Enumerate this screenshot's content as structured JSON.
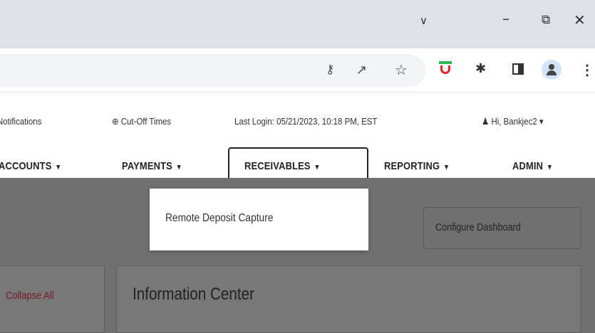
{
  "browser": {
    "window_controls": {
      "tab_search": "∨",
      "minimize": "–",
      "restore": "⧉",
      "close": "✕"
    },
    "toolbar_icons": [
      "key-icon",
      "share-icon",
      "bookmark-star-icon",
      "extension-red-icon",
      "puzzle-extensions-icon",
      "side-panel-icon",
      "profile-icon",
      "menu-kebab-icon"
    ],
    "glyphs": {
      "key": "⚷",
      "share": "↗",
      "star": "☆",
      "puzzle": "✱",
      "kebab": "⋮"
    }
  },
  "header": {
    "notifications_label": "Notifications",
    "cutoff_icon": "⊕",
    "cutoff_label": "Cut-Off Times",
    "last_login": "Last Login: 05/21/2023, 10:18 PM, EST",
    "user_icon": "♟",
    "user_greeting": "Hi, Bankjec2",
    "user_caret": "▾"
  },
  "nav": {
    "items": [
      {
        "label": "ACCOUNTS",
        "caret": "▾"
      },
      {
        "label": "PAYMENTS",
        "caret": "▾"
      },
      {
        "label": "RECEIVABLES",
        "caret": "▾",
        "active": true
      },
      {
        "label": "REPORTING",
        "caret": "▾"
      },
      {
        "label": "ADMIN",
        "caret": "▾"
      }
    ]
  },
  "dropdown": {
    "items": [
      "Remote Deposit Capture"
    ]
  },
  "main": {
    "configure_button": "Configure Dashboard",
    "collapse_all": "Collapse All",
    "info_center_title": "Information Center"
  },
  "colors": {
    "titlebar": "#dee1e6",
    "overlay": "#707070",
    "accent_link": "#7a1a2a"
  }
}
